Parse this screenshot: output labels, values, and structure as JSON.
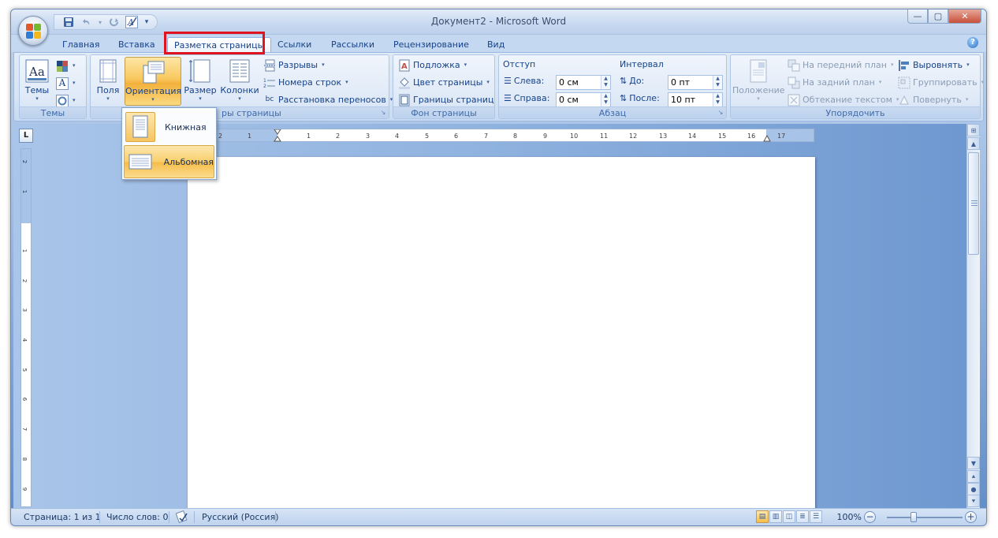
{
  "window": {
    "title": "Документ2 - Microsoft Word",
    "controls": {
      "minimize": "—",
      "maximize": "▢",
      "close": "✕"
    }
  },
  "quick_access": {
    "icons": [
      "save-icon",
      "undo-icon",
      "redo-icon",
      "spell-check-icon",
      "customize-qat-icon"
    ],
    "undo_dropdown": "▾",
    "customize_label": "▾"
  },
  "tabs": [
    {
      "label": "Главная"
    },
    {
      "label": "Вставка"
    },
    {
      "label": "Разметка страницы",
      "active": true
    },
    {
      "label": "Ссылки"
    },
    {
      "label": "Рассылки"
    },
    {
      "label": "Рецензирование"
    },
    {
      "label": "Вид"
    }
  ],
  "help_label": "?",
  "ribbon": {
    "themes": {
      "label": "Темы",
      "themes_button": "Темы",
      "arrow": "▾"
    },
    "page_setup": {
      "label": "Параметры страницы",
      "visible_label": "ры страницы",
      "margins": "Поля",
      "orientation": "Ориентация",
      "size": "Размер",
      "columns": "Колонки",
      "breaks": "Разрывы",
      "line_numbers": "Номера строк",
      "hyphenation": "Расстановка переносов"
    },
    "page_background": {
      "label": "Фон страницы",
      "watermark": "Подложка",
      "page_color": "Цвет страницы",
      "page_borders": "Границы страниц"
    },
    "paragraph": {
      "label": "Абзац",
      "indent_title": "Отступ",
      "left_label": "Слева:",
      "left_value": "0 см",
      "right_label": "Справа:",
      "right_value": "0 см",
      "spacing_title": "Интервал",
      "before_label": "До:",
      "before_value": "0 пт",
      "after_label": "После:",
      "after_value": "10 пт"
    },
    "arrange": {
      "label": "Упорядочить",
      "position": "Положение",
      "bring_to_front": "На передний план",
      "send_to_back": "На задний план",
      "text_wrapping": "Обтекание текстом",
      "align": "Выровнять",
      "group": "Группировать",
      "rotate": "Повернуть"
    },
    "dropdown_arrow": "▾",
    "launcher": "↘"
  },
  "orientation_menu": {
    "portrait": "Книжная",
    "landscape": "Альбомная",
    "selected": "landscape"
  },
  "ruler": {
    "corner": "L",
    "h_ticks": [
      "2",
      "1",
      "1",
      "2",
      "3",
      "4",
      "5",
      "6",
      "7",
      "8",
      "9",
      "10",
      "11",
      "12",
      "13",
      "14",
      "15",
      "16",
      "17"
    ],
    "v_ticks": [
      "2",
      "1",
      "1",
      "2",
      "3",
      "4",
      "5",
      "6",
      "7",
      "8",
      "9"
    ]
  },
  "statusbar": {
    "page": "Страница: 1 из 1",
    "words": "Число слов: 0",
    "language": "Русский (Россия)",
    "zoom": "100%",
    "zoom_level_percent": 100,
    "zoom_minus": "−",
    "zoom_plus": "+"
  },
  "colors": {
    "accent_highlight": "#e0141e",
    "pressed_button": "#f8c85e",
    "ribbon_text": "#15428b"
  }
}
